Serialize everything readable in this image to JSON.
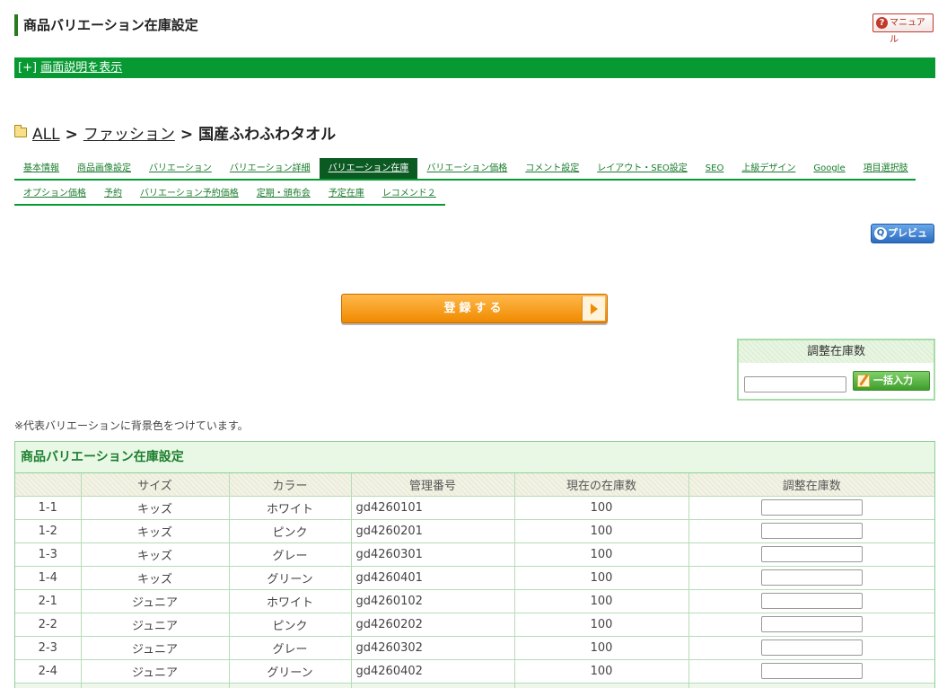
{
  "page": {
    "title": "商品バリエーション在庫設定",
    "manual_label": "マニュアル"
  },
  "help_bar": {
    "prefix": "[+]",
    "link_label": "画面説明を表示"
  },
  "breadcrumb": {
    "items": [
      "ALL",
      "ファッション"
    ],
    "separator": ">",
    "current": "国産ふわふわタオル"
  },
  "tabs_row1": [
    {
      "label": "基本情報"
    },
    {
      "label": "商品画像設定"
    },
    {
      "label": "バリエーション"
    },
    {
      "label": "バリエーション詳細"
    },
    {
      "label": "バリエーション在庫"
    },
    {
      "label": "バリエーション価格"
    },
    {
      "label": "コメント設定"
    },
    {
      "label": "レイアウト・SEO設定"
    },
    {
      "label": "SEO"
    },
    {
      "label": "上級デザイン"
    },
    {
      "label": "Google"
    },
    {
      "label": "項目選択肢"
    }
  ],
  "tabs_row2": [
    {
      "label": "オプション価格"
    },
    {
      "label": "予約"
    },
    {
      "label": "バリエーション予約価格"
    },
    {
      "label": "定期・頒布会"
    },
    {
      "label": "予定在庫"
    },
    {
      "label": "レコメンド２"
    }
  ],
  "preview_label": "プレビュー",
  "register_label": "登録する",
  "adjust_box": {
    "title": "調整在庫数",
    "input_value": "",
    "bulk_label": "一括入力"
  },
  "note": "※代表バリエーションに背景色をつけています。",
  "table": {
    "title": "商品バリエーション在庫設定",
    "headers": [
      "",
      "サイズ",
      "カラー",
      "管理番号",
      "現在の在庫数",
      "調整在庫数"
    ],
    "rows": [
      [
        "1-1",
        "キッズ",
        "ホワイト",
        "gd4260101",
        "100"
      ],
      [
        "1-2",
        "キッズ",
        "ピンク",
        "gd4260201",
        "100"
      ],
      [
        "1-3",
        "キッズ",
        "グレー",
        "gd4260301",
        "100"
      ],
      [
        "1-4",
        "キッズ",
        "グリーン",
        "gd4260401",
        "100"
      ],
      [
        "2-1",
        "ジュニア",
        "ホワイト",
        "gd4260102",
        "100"
      ],
      [
        "2-2",
        "ジュニア",
        "ピンク",
        "gd4260202",
        "100"
      ],
      [
        "2-3",
        "ジュニア",
        "グレー",
        "gd4260302",
        "100"
      ],
      [
        "2-4",
        "ジュニア",
        "グリーン",
        "gd4260402",
        "100"
      ]
    ]
  },
  "colors": {
    "accent_green": "#079a33",
    "active_tab": "#0a5a22",
    "register_orange": "#f08a00",
    "preview_blue": "#2c6cc0"
  }
}
